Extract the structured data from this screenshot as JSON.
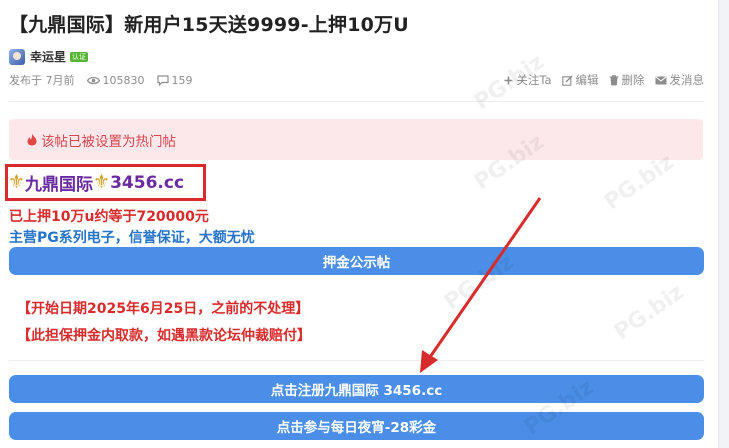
{
  "post": {
    "title": "【九鼎国际】新用户15天送9999-上押10万U",
    "author": "幸运星",
    "author_badge": "认证",
    "published": "发布于 7月前",
    "views": "105830",
    "comments": "159"
  },
  "actions": {
    "follow": "关注Ta",
    "edit": "编辑",
    "delete": "删除",
    "message": "发消息"
  },
  "hot_notice": "该帖已被设置为热门帖",
  "content": {
    "brand_name": "九鼎国际",
    "brand_domain": "3456.cc",
    "line_deposit": "已上押10万u约等于720000元",
    "line_main": "主营PG系列电子，信誉保证，大额无忧",
    "deposit_button": "押金公示帖",
    "notice1": "【开始日期2025年6月25日，之前的不处理】",
    "notice2": "【此担保押金内取款，如遇黑款论坛仲裁赔付】",
    "register_button": "点击注册九鼎国际 3456.cc",
    "join_button": "点击参与每日夜宵-28彩金"
  },
  "watermark_text": "PG.biz",
  "colors": {
    "accent_blue": "#4a8ee8",
    "red": "#d92b2b",
    "purple": "#6a2ba0",
    "text_blue": "#2574c9",
    "hot_bg": "#fce8ea"
  },
  "icons": [
    "eye-icon",
    "comment-icon",
    "plus-icon",
    "edit-icon",
    "trash-icon",
    "envelope-icon",
    "fire-icon",
    "fleur-de-lis-icon"
  ]
}
